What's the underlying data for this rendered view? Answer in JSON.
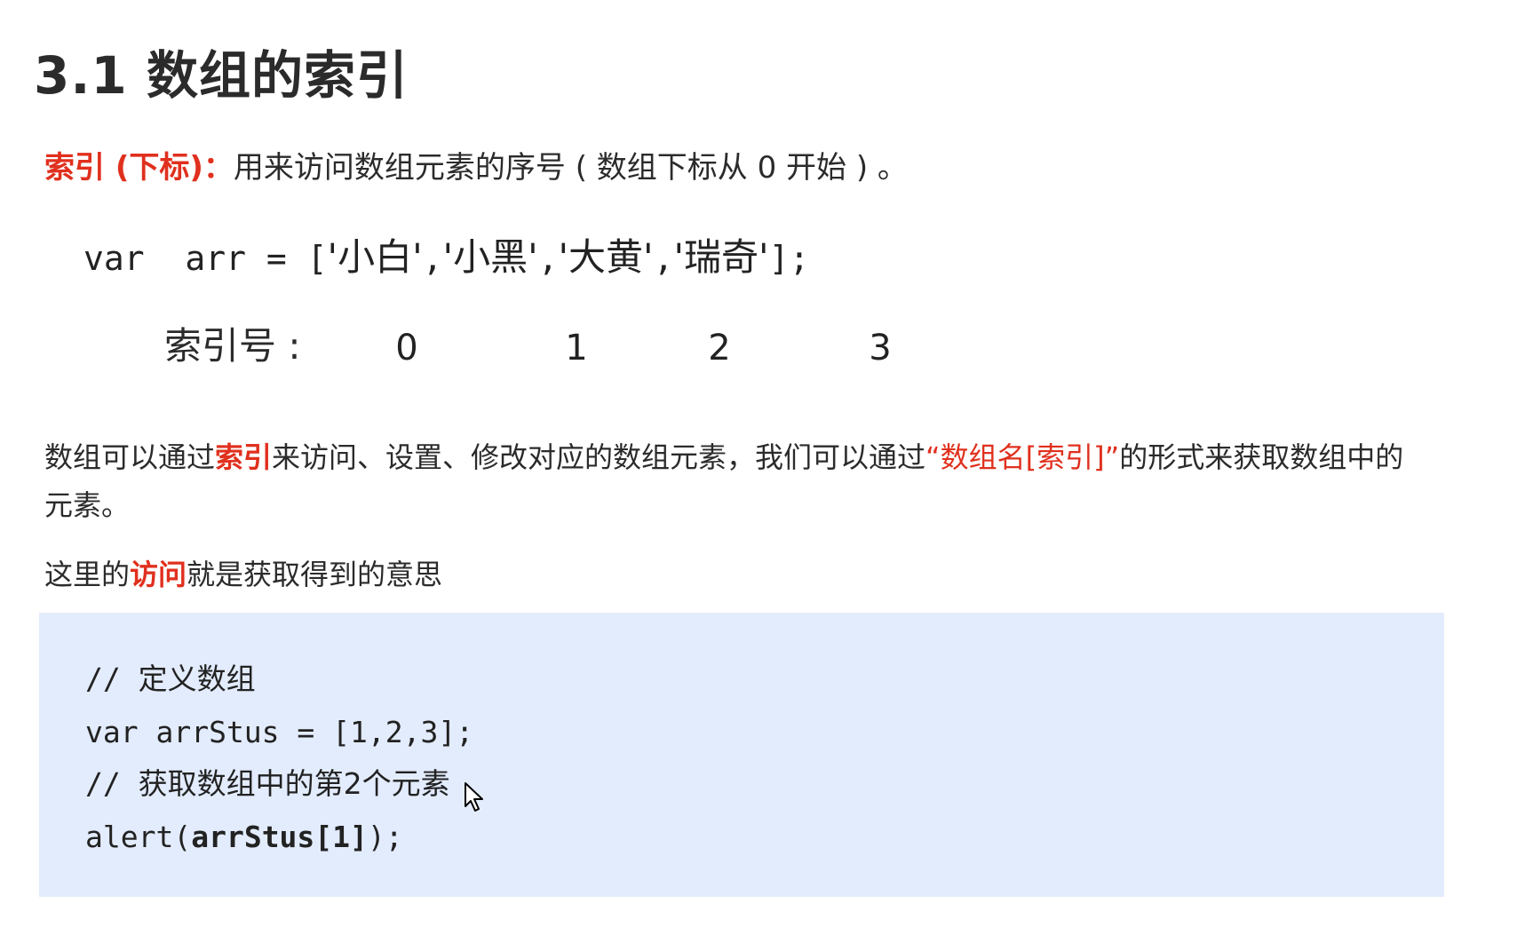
{
  "title": "3.1 数组的索引",
  "definition": {
    "term": "索引 (下标)：",
    "text": "用来访问数组元素的序号 ( 数组下标从 0 开始 ) 。"
  },
  "example": {
    "code_prefix": "var  arr = [",
    "items": [
      "'小白'",
      "'小黑'",
      "'大黄'",
      "'瑞奇'"
    ],
    "separator": ",",
    "code_suffix": "];",
    "index_label": "索引号 :",
    "indices": [
      "0",
      "1",
      "2",
      "3"
    ]
  },
  "paragraph1": {
    "part1": "数组可以通过",
    "highlight1": "索引",
    "part2": "来访问、设置、修改对应的数组元素，我们可以通过",
    "highlight2": "“数组名[索引]”",
    "part3": "的形式来获取数组中的元素。"
  },
  "paragraph2": {
    "part1": "这里的",
    "highlight": "访问",
    "part2": "就是获取得到的意思"
  },
  "code_block": {
    "line1_prefix": "// ",
    "line1_comment": "定义数组",
    "line2": "var arrStus = [1,2,3];",
    "line3_prefix": "// ",
    "line3_comment": "获取数组中的第2个元素",
    "line4_prefix": "alert(",
    "line4_bold": "arrStus[1]",
    "line4_suffix": ");"
  },
  "colors": {
    "accent": "#e0301e",
    "code_background": "#e3ecfd",
    "text": "#2b2b2b"
  },
  "icons": {
    "cursor": "mouse-pointer-icon"
  }
}
